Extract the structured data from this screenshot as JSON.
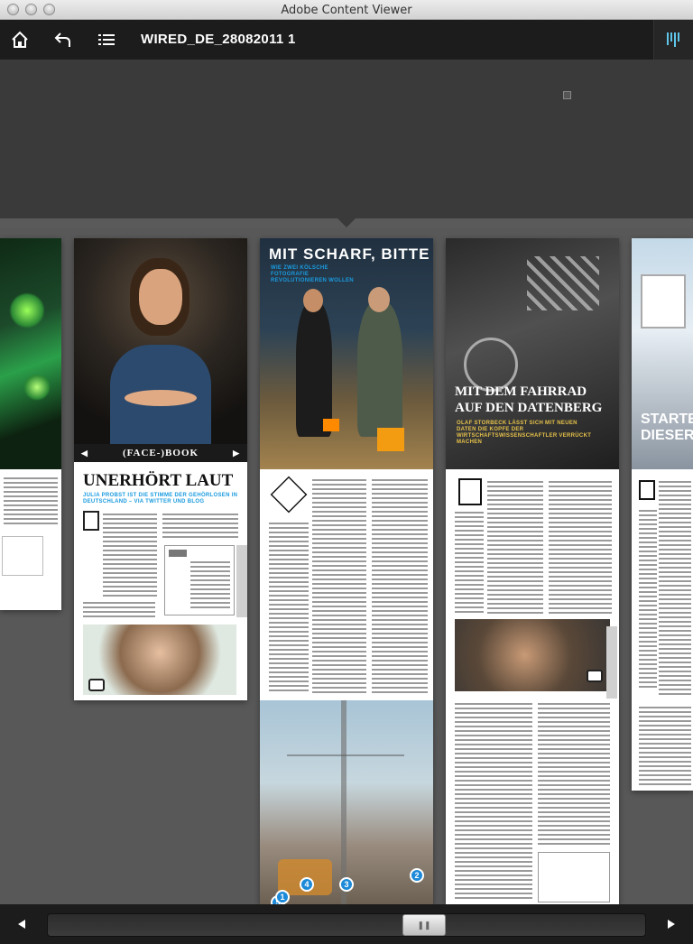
{
  "window": {
    "title": "Adobe Content Viewer"
  },
  "toolbar": {
    "home_icon": "home-icon",
    "back_icon": "back-icon",
    "toc_icon": "list-icon",
    "doc_title": "WIRED_DE_28082011 1",
    "browse_icon": "browse-mode-icon"
  },
  "pages": {
    "page_face_book": {
      "caption": "(FACE-)BOOK",
      "headline": "UNERHÖRT LAUT",
      "subhead": "JULIA PROBST IST DIE STIMME DER GEHÖRLOSEN IN DEUTSCHLAND – VIA TWITTER UND BLOG"
    },
    "page_mit_scharf": {
      "headline": "MIT SCHARF, BITTE",
      "subhead": "WIE ZWEI KÖLSCHE FOTOGRAFIE REVOLUTIONIEREN WOLLEN",
      "markers": [
        "4",
        "3",
        "2",
        "5",
        "1"
      ]
    },
    "page_fahrrad": {
      "headline_1": "MIT DEM FAHRRAD",
      "headline_2": "AUF DEN DATENBERG",
      "subhead": "OLAF STORBECK LÄSST SICH MIT NEUEN DATEN DIE KOPFE DER WIRTSCHAFTSWISSENSCHAFTLER VERRÜCKT MACHEN"
    },
    "page_starte": {
      "headline_1": "STARTE",
      "headline_2": "DIESER"
    }
  },
  "bottombar": {
    "prev_icon": "prev-arrow-icon",
    "next_icon": "next-arrow-icon",
    "scrubber_position": 0.64
  },
  "colors": {
    "accent": "#1a9be0",
    "toolbar": "#1c1c1c",
    "browse_icon": "#5fc6ea"
  }
}
